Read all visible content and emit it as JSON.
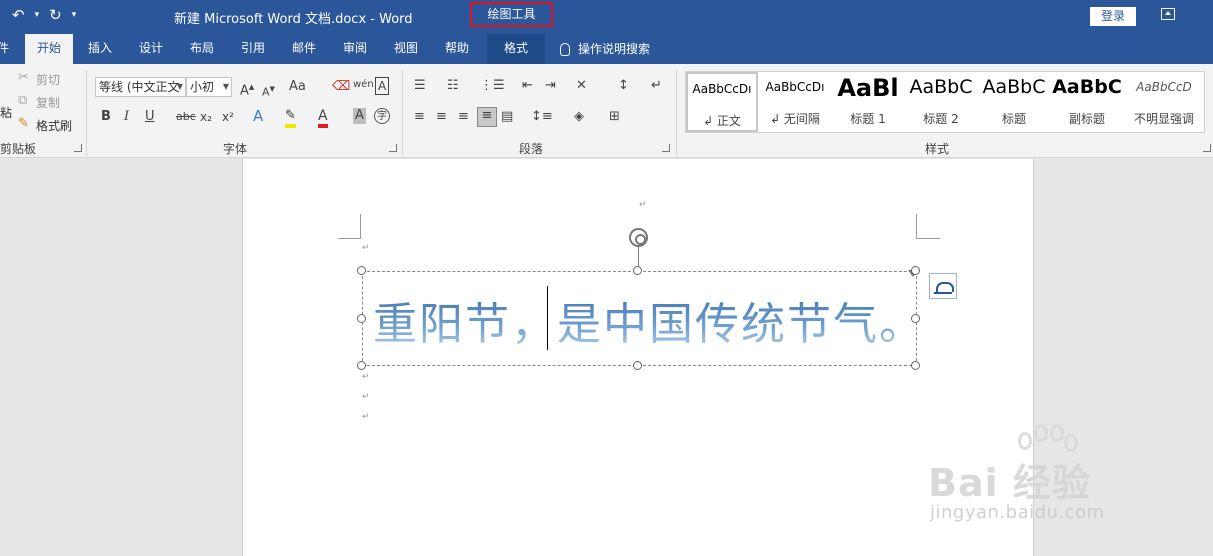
{
  "titlebar": {
    "undo_icon": "undo-arrow",
    "redo_icon": "redo-circle",
    "doc_title": "新建 Microsoft Word 文档.docx  -  Word",
    "context_tools": "绘图工具",
    "login": "登录",
    "accent": "#2b579a",
    "highlight": "#e0141e"
  },
  "tabs": [
    {
      "label": "件"
    },
    {
      "label": "开始"
    },
    {
      "label": "插入"
    },
    {
      "label": "设计"
    },
    {
      "label": "布局"
    },
    {
      "label": "引用"
    },
    {
      "label": "邮件"
    },
    {
      "label": "审阅"
    },
    {
      "label": "视图"
    },
    {
      "label": "帮助"
    },
    {
      "label": "格式"
    }
  ],
  "search_tab": "操作说明搜索",
  "clipboard": {
    "paste": "粘",
    "cut": "剪切",
    "copy": "复制",
    "format_painter": "格式刷",
    "label": "剪贴板"
  },
  "font": {
    "font_name": "等线 (中文正文",
    "font_size": "小初",
    "label": "字体",
    "btn_aa": "Aa",
    "btn_bold": "B",
    "btn_italic": "I",
    "btn_underline": "U",
    "btn_strike": "abc",
    "btn_sub": "x₂",
    "btn_sup": "x²",
    "btn_textfx": "A",
    "btn_fontcolor": "A",
    "btn_shade": "A",
    "btn_enclose": "字",
    "btn_phonetic": "wén",
    "btn_border": "A"
  },
  "paragraph": {
    "label": "段落"
  },
  "styles": {
    "label": "样式",
    "items": [
      {
        "sample": "AaBbCcDı",
        "name": "↲ 正文"
      },
      {
        "sample": "AaBbCcDı",
        "name": "↲ 无间隔"
      },
      {
        "sample": "AaBl",
        "name": "标题 1"
      },
      {
        "sample": "AaBbC",
        "name": "标题 2"
      },
      {
        "sample": "AaBbC",
        "name": "标题"
      },
      {
        "sample": "AaBbC",
        "name": "副标题"
      },
      {
        "sample": "AaBbCcD",
        "name": "不明显强调"
      }
    ]
  },
  "document": {
    "wordart_text": "重阳节，是中国传统节气。",
    "para_mark": "↵"
  },
  "watermark": {
    "brand": "Bai 经验",
    "url": "jingyan.baidu.com"
  }
}
